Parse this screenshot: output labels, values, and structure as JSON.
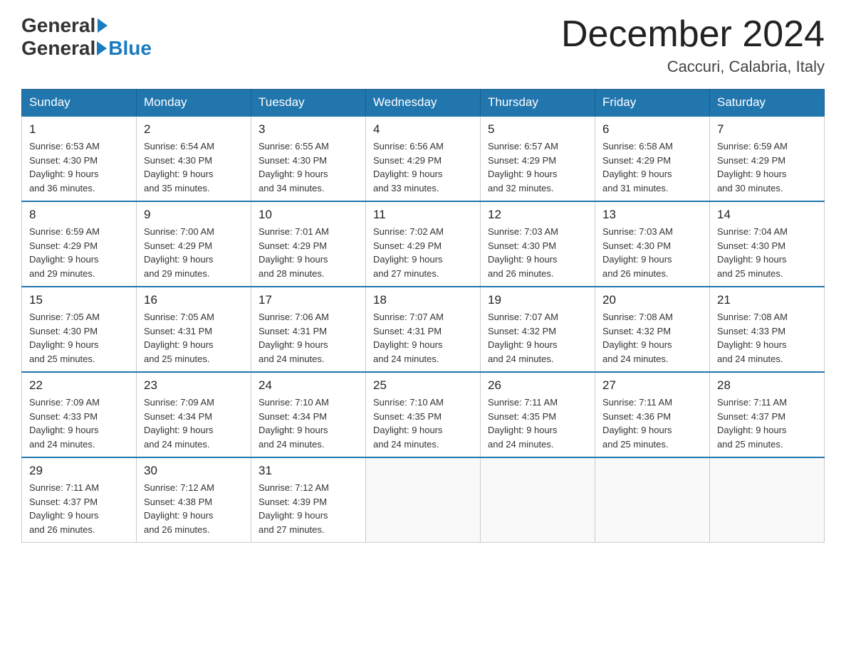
{
  "header": {
    "logo_general": "General",
    "logo_blue": "Blue",
    "title": "December 2024",
    "subtitle": "Caccuri, Calabria, Italy"
  },
  "columns": [
    "Sunday",
    "Monday",
    "Tuesday",
    "Wednesday",
    "Thursday",
    "Friday",
    "Saturday"
  ],
  "weeks": [
    [
      {
        "day": "1",
        "info": "Sunrise: 6:53 AM\nSunset: 4:30 PM\nDaylight: 9 hours\nand 36 minutes."
      },
      {
        "day": "2",
        "info": "Sunrise: 6:54 AM\nSunset: 4:30 PM\nDaylight: 9 hours\nand 35 minutes."
      },
      {
        "day": "3",
        "info": "Sunrise: 6:55 AM\nSunset: 4:30 PM\nDaylight: 9 hours\nand 34 minutes."
      },
      {
        "day": "4",
        "info": "Sunrise: 6:56 AM\nSunset: 4:29 PM\nDaylight: 9 hours\nand 33 minutes."
      },
      {
        "day": "5",
        "info": "Sunrise: 6:57 AM\nSunset: 4:29 PM\nDaylight: 9 hours\nand 32 minutes."
      },
      {
        "day": "6",
        "info": "Sunrise: 6:58 AM\nSunset: 4:29 PM\nDaylight: 9 hours\nand 31 minutes."
      },
      {
        "day": "7",
        "info": "Sunrise: 6:59 AM\nSunset: 4:29 PM\nDaylight: 9 hours\nand 30 minutes."
      }
    ],
    [
      {
        "day": "8",
        "info": "Sunrise: 6:59 AM\nSunset: 4:29 PM\nDaylight: 9 hours\nand 29 minutes."
      },
      {
        "day": "9",
        "info": "Sunrise: 7:00 AM\nSunset: 4:29 PM\nDaylight: 9 hours\nand 29 minutes."
      },
      {
        "day": "10",
        "info": "Sunrise: 7:01 AM\nSunset: 4:29 PM\nDaylight: 9 hours\nand 28 minutes."
      },
      {
        "day": "11",
        "info": "Sunrise: 7:02 AM\nSunset: 4:29 PM\nDaylight: 9 hours\nand 27 minutes."
      },
      {
        "day": "12",
        "info": "Sunrise: 7:03 AM\nSunset: 4:30 PM\nDaylight: 9 hours\nand 26 minutes."
      },
      {
        "day": "13",
        "info": "Sunrise: 7:03 AM\nSunset: 4:30 PM\nDaylight: 9 hours\nand 26 minutes."
      },
      {
        "day": "14",
        "info": "Sunrise: 7:04 AM\nSunset: 4:30 PM\nDaylight: 9 hours\nand 25 minutes."
      }
    ],
    [
      {
        "day": "15",
        "info": "Sunrise: 7:05 AM\nSunset: 4:30 PM\nDaylight: 9 hours\nand 25 minutes."
      },
      {
        "day": "16",
        "info": "Sunrise: 7:05 AM\nSunset: 4:31 PM\nDaylight: 9 hours\nand 25 minutes."
      },
      {
        "day": "17",
        "info": "Sunrise: 7:06 AM\nSunset: 4:31 PM\nDaylight: 9 hours\nand 24 minutes."
      },
      {
        "day": "18",
        "info": "Sunrise: 7:07 AM\nSunset: 4:31 PM\nDaylight: 9 hours\nand 24 minutes."
      },
      {
        "day": "19",
        "info": "Sunrise: 7:07 AM\nSunset: 4:32 PM\nDaylight: 9 hours\nand 24 minutes."
      },
      {
        "day": "20",
        "info": "Sunrise: 7:08 AM\nSunset: 4:32 PM\nDaylight: 9 hours\nand 24 minutes."
      },
      {
        "day": "21",
        "info": "Sunrise: 7:08 AM\nSunset: 4:33 PM\nDaylight: 9 hours\nand 24 minutes."
      }
    ],
    [
      {
        "day": "22",
        "info": "Sunrise: 7:09 AM\nSunset: 4:33 PM\nDaylight: 9 hours\nand 24 minutes."
      },
      {
        "day": "23",
        "info": "Sunrise: 7:09 AM\nSunset: 4:34 PM\nDaylight: 9 hours\nand 24 minutes."
      },
      {
        "day": "24",
        "info": "Sunrise: 7:10 AM\nSunset: 4:34 PM\nDaylight: 9 hours\nand 24 minutes."
      },
      {
        "day": "25",
        "info": "Sunrise: 7:10 AM\nSunset: 4:35 PM\nDaylight: 9 hours\nand 24 minutes."
      },
      {
        "day": "26",
        "info": "Sunrise: 7:11 AM\nSunset: 4:35 PM\nDaylight: 9 hours\nand 24 minutes."
      },
      {
        "day": "27",
        "info": "Sunrise: 7:11 AM\nSunset: 4:36 PM\nDaylight: 9 hours\nand 25 minutes."
      },
      {
        "day": "28",
        "info": "Sunrise: 7:11 AM\nSunset: 4:37 PM\nDaylight: 9 hours\nand 25 minutes."
      }
    ],
    [
      {
        "day": "29",
        "info": "Sunrise: 7:11 AM\nSunset: 4:37 PM\nDaylight: 9 hours\nand 26 minutes."
      },
      {
        "day": "30",
        "info": "Sunrise: 7:12 AM\nSunset: 4:38 PM\nDaylight: 9 hours\nand 26 minutes."
      },
      {
        "day": "31",
        "info": "Sunrise: 7:12 AM\nSunset: 4:39 PM\nDaylight: 9 hours\nand 27 minutes."
      },
      null,
      null,
      null,
      null
    ]
  ]
}
